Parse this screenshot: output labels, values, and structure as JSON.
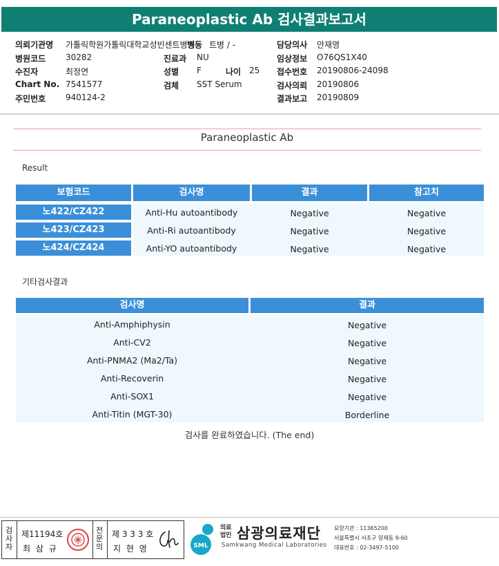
{
  "title": "Paraneoplastic Ab 검사결과보고서",
  "info": {
    "hospital_label": "의뢰기관명",
    "hospital_value": "가톨릭학원가톨릭대학교성빈센트병원",
    "ward_label": "병동",
    "ward_value": "트병 / -",
    "code_label": "병원코드",
    "code_value": "30282",
    "dept_label": "진료과",
    "dept_value": "NU",
    "patient_label": "수진자",
    "patient_value": "최정연",
    "sex_label": "성별",
    "sex_value": "F",
    "age_label": "나이",
    "age_value": "25",
    "chart_label": "Chart No.",
    "chart_value": "7541577",
    "specimen_label": "검체",
    "specimen_value": "SST Serum",
    "id_label": "주민번호",
    "id_value": "940124-2",
    "doctor_label": "담당의사",
    "doctor_value": "안재영",
    "clinical_label": "임상정보",
    "clinical_value": "O76QS1X40",
    "receipt_label": "접수번호",
    "receipt_value": "20190806-24098",
    "request_label": "검사의뢰",
    "request_value": "20190806",
    "report_label": "결과보고",
    "report_value": "20190809"
  },
  "section_title": "Paraneoplastic Ab",
  "result_label": "Result",
  "table1": {
    "headers": [
      "보험코드",
      "검사명",
      "결과",
      "참고치"
    ],
    "rows": [
      {
        "code": "노422/CZ422",
        "test": "Anti-Hu autoantibody",
        "result": "Negative",
        "ref": "Negative"
      },
      {
        "code": "노423/CZ423",
        "test": "Anti-Ri autoantibody",
        "result": "Negative",
        "ref": "Negative"
      },
      {
        "code": "노424/CZ424",
        "test": "Anti-YO autoantibody",
        "result": "Negative",
        "ref": "Negative"
      }
    ]
  },
  "other_label": "기타검사결과",
  "table2": {
    "headers": [
      "검사명",
      "결과"
    ],
    "rows": [
      {
        "test": "Anti-Amphiphysin",
        "result": "Negative"
      },
      {
        "test": "Anti-CV2",
        "result": "Negative"
      },
      {
        "test": "Anti-PNMA2 (Ma2/Ta)",
        "result": "Negative"
      },
      {
        "test": "Anti-Recoverin",
        "result": "Negative"
      },
      {
        "test": "Anti-SOX1",
        "result": "Negative"
      },
      {
        "test": "Anti-Titin (MGT-30)",
        "result": "Borderline"
      }
    ]
  },
  "end_text": "검사를 완료하였습니다. (The end)",
  "signature": {
    "inspector_label": "검사자",
    "inspector_number": "제11194호",
    "inspector_name": "최 삼 규",
    "specialist_label": "전문의",
    "specialist_number": "제 3 3 3 호",
    "specialist_name": "지 현 영",
    "signature_mark": "ch"
  },
  "footer": {
    "corp_small_1": "의료",
    "corp_small_2": "법인",
    "corp_name": "삼광의료재단",
    "corp_english": "Samkwang Medical Laboratories",
    "logo_text": "SML",
    "code_line": "요양기관 : 11365200",
    "address_line": "서울특별시 서초구 양재동 9-60",
    "phone_line": "대표번호 : 02-3497-5100"
  },
  "colors": {
    "header": "#0f7f73",
    "table_header": "#3b8fd8",
    "row_bg": "#eef8fd",
    "accent_line": "#e8a2a2"
  }
}
